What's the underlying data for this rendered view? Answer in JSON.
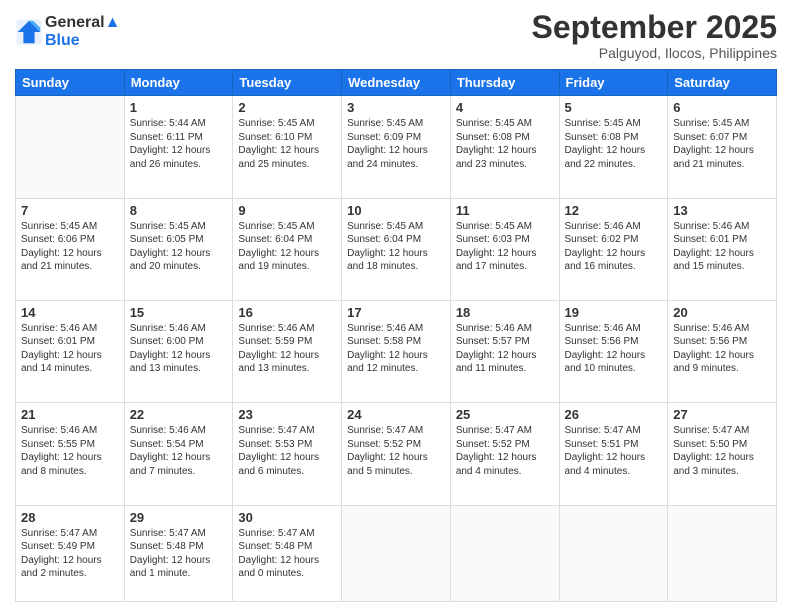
{
  "header": {
    "logo_line1": "General",
    "logo_line2": "Blue",
    "month": "September 2025",
    "location": "Palguyod, Ilocos, Philippines"
  },
  "days_of_week": [
    "Sunday",
    "Monday",
    "Tuesday",
    "Wednesday",
    "Thursday",
    "Friday",
    "Saturday"
  ],
  "weeks": [
    [
      {
        "day": "",
        "info": ""
      },
      {
        "day": "1",
        "info": "Sunrise: 5:44 AM\nSunset: 6:11 PM\nDaylight: 12 hours\nand 26 minutes."
      },
      {
        "day": "2",
        "info": "Sunrise: 5:45 AM\nSunset: 6:10 PM\nDaylight: 12 hours\nand 25 minutes."
      },
      {
        "day": "3",
        "info": "Sunrise: 5:45 AM\nSunset: 6:09 PM\nDaylight: 12 hours\nand 24 minutes."
      },
      {
        "day": "4",
        "info": "Sunrise: 5:45 AM\nSunset: 6:08 PM\nDaylight: 12 hours\nand 23 minutes."
      },
      {
        "day": "5",
        "info": "Sunrise: 5:45 AM\nSunset: 6:08 PM\nDaylight: 12 hours\nand 22 minutes."
      },
      {
        "day": "6",
        "info": "Sunrise: 5:45 AM\nSunset: 6:07 PM\nDaylight: 12 hours\nand 21 minutes."
      }
    ],
    [
      {
        "day": "7",
        "info": "Sunrise: 5:45 AM\nSunset: 6:06 PM\nDaylight: 12 hours\nand 21 minutes."
      },
      {
        "day": "8",
        "info": "Sunrise: 5:45 AM\nSunset: 6:05 PM\nDaylight: 12 hours\nand 20 minutes."
      },
      {
        "day": "9",
        "info": "Sunrise: 5:45 AM\nSunset: 6:04 PM\nDaylight: 12 hours\nand 19 minutes."
      },
      {
        "day": "10",
        "info": "Sunrise: 5:45 AM\nSunset: 6:04 PM\nDaylight: 12 hours\nand 18 minutes."
      },
      {
        "day": "11",
        "info": "Sunrise: 5:45 AM\nSunset: 6:03 PM\nDaylight: 12 hours\nand 17 minutes."
      },
      {
        "day": "12",
        "info": "Sunrise: 5:46 AM\nSunset: 6:02 PM\nDaylight: 12 hours\nand 16 minutes."
      },
      {
        "day": "13",
        "info": "Sunrise: 5:46 AM\nSunset: 6:01 PM\nDaylight: 12 hours\nand 15 minutes."
      }
    ],
    [
      {
        "day": "14",
        "info": "Sunrise: 5:46 AM\nSunset: 6:01 PM\nDaylight: 12 hours\nand 14 minutes."
      },
      {
        "day": "15",
        "info": "Sunrise: 5:46 AM\nSunset: 6:00 PM\nDaylight: 12 hours\nand 13 minutes."
      },
      {
        "day": "16",
        "info": "Sunrise: 5:46 AM\nSunset: 5:59 PM\nDaylight: 12 hours\nand 13 minutes."
      },
      {
        "day": "17",
        "info": "Sunrise: 5:46 AM\nSunset: 5:58 PM\nDaylight: 12 hours\nand 12 minutes."
      },
      {
        "day": "18",
        "info": "Sunrise: 5:46 AM\nSunset: 5:57 PM\nDaylight: 12 hours\nand 11 minutes."
      },
      {
        "day": "19",
        "info": "Sunrise: 5:46 AM\nSunset: 5:56 PM\nDaylight: 12 hours\nand 10 minutes."
      },
      {
        "day": "20",
        "info": "Sunrise: 5:46 AM\nSunset: 5:56 PM\nDaylight: 12 hours\nand 9 minutes."
      }
    ],
    [
      {
        "day": "21",
        "info": "Sunrise: 5:46 AM\nSunset: 5:55 PM\nDaylight: 12 hours\nand 8 minutes."
      },
      {
        "day": "22",
        "info": "Sunrise: 5:46 AM\nSunset: 5:54 PM\nDaylight: 12 hours\nand 7 minutes."
      },
      {
        "day": "23",
        "info": "Sunrise: 5:47 AM\nSunset: 5:53 PM\nDaylight: 12 hours\nand 6 minutes."
      },
      {
        "day": "24",
        "info": "Sunrise: 5:47 AM\nSunset: 5:52 PM\nDaylight: 12 hours\nand 5 minutes."
      },
      {
        "day": "25",
        "info": "Sunrise: 5:47 AM\nSunset: 5:52 PM\nDaylight: 12 hours\nand 4 minutes."
      },
      {
        "day": "26",
        "info": "Sunrise: 5:47 AM\nSunset: 5:51 PM\nDaylight: 12 hours\nand 4 minutes."
      },
      {
        "day": "27",
        "info": "Sunrise: 5:47 AM\nSunset: 5:50 PM\nDaylight: 12 hours\nand 3 minutes."
      }
    ],
    [
      {
        "day": "28",
        "info": "Sunrise: 5:47 AM\nSunset: 5:49 PM\nDaylight: 12 hours\nand 2 minutes."
      },
      {
        "day": "29",
        "info": "Sunrise: 5:47 AM\nSunset: 5:48 PM\nDaylight: 12 hours\nand 1 minute."
      },
      {
        "day": "30",
        "info": "Sunrise: 5:47 AM\nSunset: 5:48 PM\nDaylight: 12 hours\nand 0 minutes."
      },
      {
        "day": "",
        "info": ""
      },
      {
        "day": "",
        "info": ""
      },
      {
        "day": "",
        "info": ""
      },
      {
        "day": "",
        "info": ""
      }
    ]
  ]
}
